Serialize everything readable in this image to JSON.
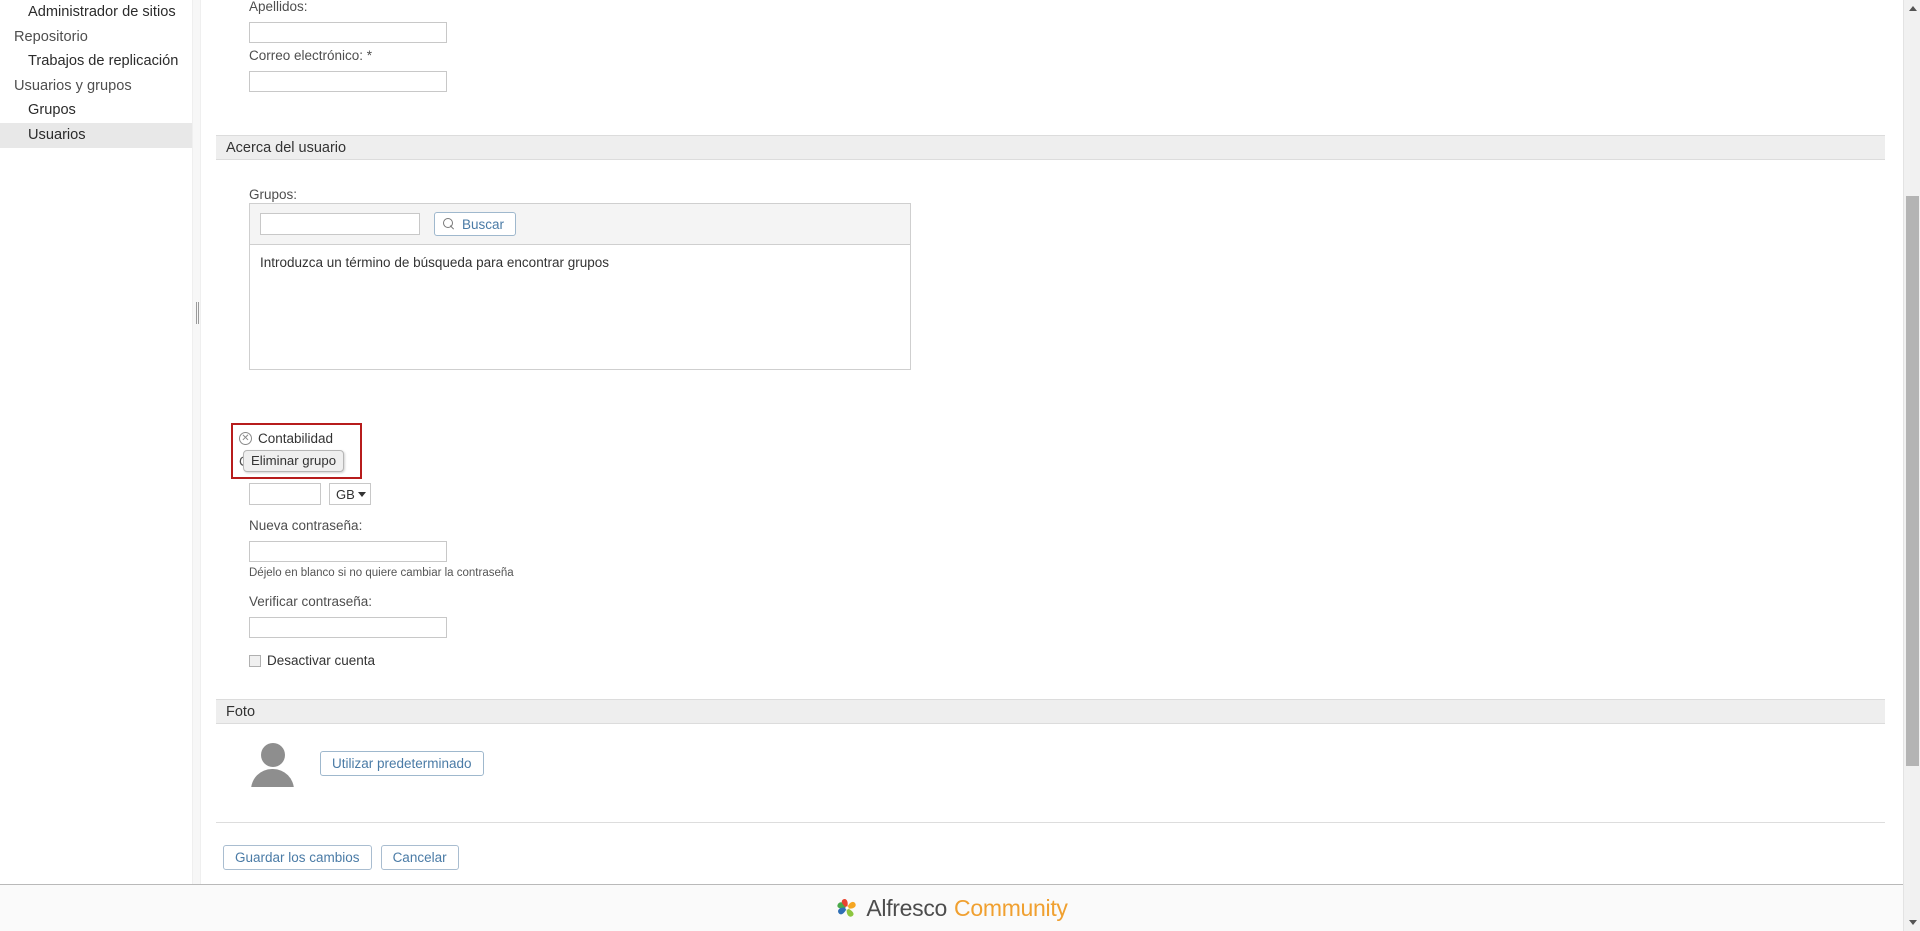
{
  "sidebar": {
    "items": [
      {
        "label": "Administrador de sitios",
        "level": "child",
        "selected": false
      },
      {
        "label": "Repositorio",
        "level": "parent",
        "selected": false
      },
      {
        "label": "Trabajos de replicación",
        "level": "child",
        "selected": false
      },
      {
        "label": "Usuarios y grupos",
        "level": "parent",
        "selected": false
      },
      {
        "label": "Grupos",
        "level": "child",
        "selected": false
      },
      {
        "label": "Usuarios",
        "level": "child",
        "selected": true
      }
    ]
  },
  "form": {
    "lastname_label": "Apellidos:",
    "lastname_value": "",
    "email_label": "Correo electrónico: *",
    "email_value": "",
    "about_section_title": "Acerca del usuario",
    "groups_label": "Grupos:",
    "group_search_value": "",
    "search_button_label": "Buscar",
    "search_icon": "search-icon",
    "finder_empty_message": "Introduzca un término de búsqueda para encontrar grupos",
    "selected_group": "Contabilidad",
    "remove_group_icon": "remove-circle-icon",
    "tooltip_text": "Eliminar grupo",
    "quota_label_partial": "Cu",
    "quota_value": "",
    "quota_unit": "GB",
    "quota_unit_caret": "chevron-down-icon",
    "new_password_label": "Nueva contraseña:",
    "new_password_value": "",
    "password_hint": "Déjelo en blanco si no quiere cambiar la contraseña",
    "verify_password_label": "Verificar contraseña:",
    "verify_password_value": "",
    "disable_account_label": "Desactivar cuenta",
    "disable_account_checked": false,
    "photo_section_title": "Foto",
    "avatar_icon": "user-avatar-icon",
    "use_default_button": "Utilizar predeterminado",
    "save_button": "Guardar los cambios",
    "cancel_button": "Cancelar"
  },
  "footer": {
    "logo_icon": "alfresco-pinwheel-icon",
    "brand_primary": "Alfresco",
    "brand_secondary": "Community"
  },
  "scrollbar": {
    "up_icon": "chevron-up-icon",
    "down_icon": "chevron-down-icon"
  },
  "colors": {
    "highlight_border": "#b71c1c",
    "link_blue": "#4a7ba6",
    "brand_orange": "#f0a030",
    "section_bg": "#eeeeee"
  }
}
